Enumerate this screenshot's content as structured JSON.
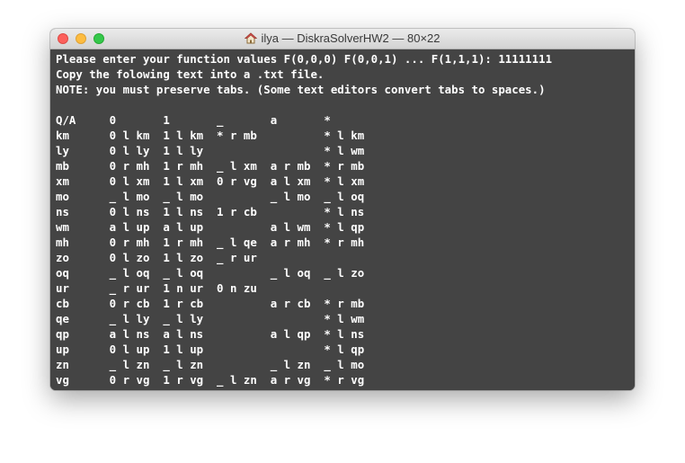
{
  "window": {
    "title": "ilya — DiskraSolverHW2 — 80×22",
    "title_icon": "home-icon"
  },
  "colors": {
    "terminal_bg": "#444444",
    "terminal_fg": "#ffffff",
    "close": "#fc605c",
    "minimize": "#fdbc40",
    "maximize": "#34c84a"
  },
  "terminal": {
    "lines": [
      "Please enter your function values F(0,0,0) F(0,0,1) ... F(1,1,1): 11111111",
      "Copy the folowing text into a .txt file.",
      "NOTE: you must preserve tabs. (Some text editors convert tabs to spaces.)",
      "",
      "Q/A     0       1       _       a       *",
      "km      0 l km  1 l km  * r mb          * l km",
      "ly      0 l ly  1 l ly                  * l wm",
      "mb      0 r mh  1 r mh  _ l xm  a r mb  * r mb",
      "xm      0 l xm  1 l xm  0 r vg  a l xm  * l xm",
      "mo      _ l mo  _ l mo          _ l mo  _ l oq",
      "ns      0 l ns  1 l ns  1 r cb          * l ns",
      "wm      a l up  a l up          a l wm  * l qp",
      "mh      0 r mh  1 r mh  _ l qe  a r mh  * r mh",
      "zo      0 l zo  1 l zo  _ r ur",
      "oq      _ l oq  _ l oq          _ l oq  _ l zo",
      "ur      _ r ur  1 n ur  0 n zu",
      "cb      0 r cb  1 r cb          a r cb  * r mb",
      "qe      _ l ly  _ l ly                  * l wm",
      "qp      a l ns  a l ns          a l qp  * l ns",
      "up      0 l up  1 l up                  * l qp",
      "zn      _ l zn  _ l zn          _ l zn  _ l mo",
      "vg      0 r vg  1 r vg  _ l zn  a r vg  * r vg"
    ]
  }
}
